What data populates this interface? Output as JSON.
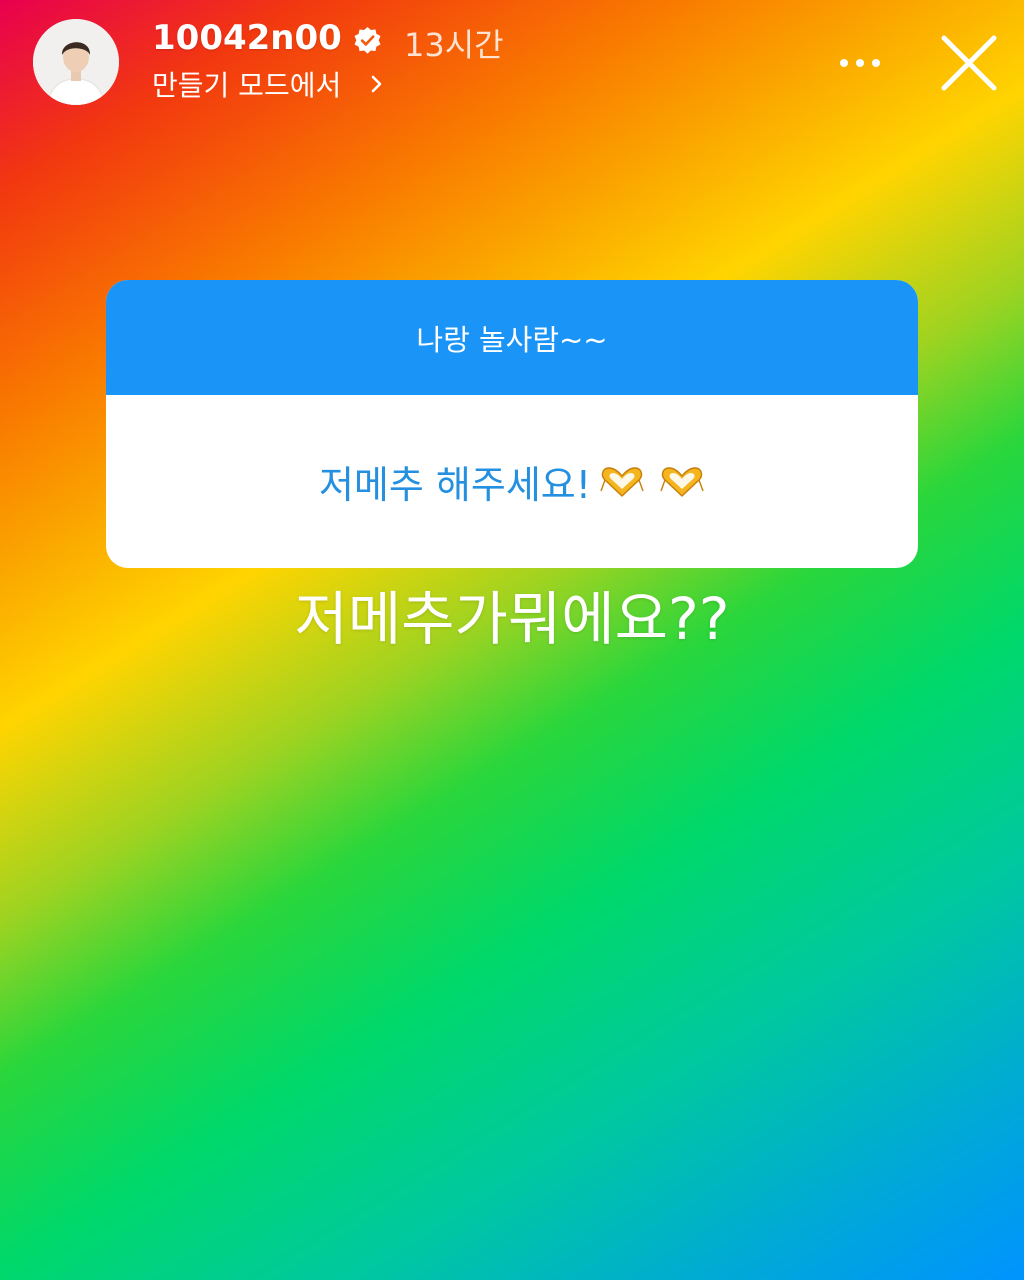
{
  "header": {
    "username": "10042n00",
    "time": "13시간",
    "subtitle": "만들기 모드에서",
    "avatar": "profile-photo",
    "icons": [
      "verified-badge-icon",
      "chevron-right-icon",
      "more-options-icon",
      "close-icon"
    ]
  },
  "question_sticker": {
    "question": "나랑 놀사람~~",
    "answer": "저메추 해주세요!",
    "answer_emoji": [
      "heart-hands-emoji",
      "heart-hands-emoji"
    ]
  },
  "caption": "저메추가뭐에요??",
  "colors": {
    "sticker_header": "#1a94f7",
    "answer_text": "#2590e0",
    "background_gradient": [
      "#e8004f",
      "#f97a00",
      "#ffd400",
      "#2ad63b",
      "#0093ff"
    ]
  }
}
